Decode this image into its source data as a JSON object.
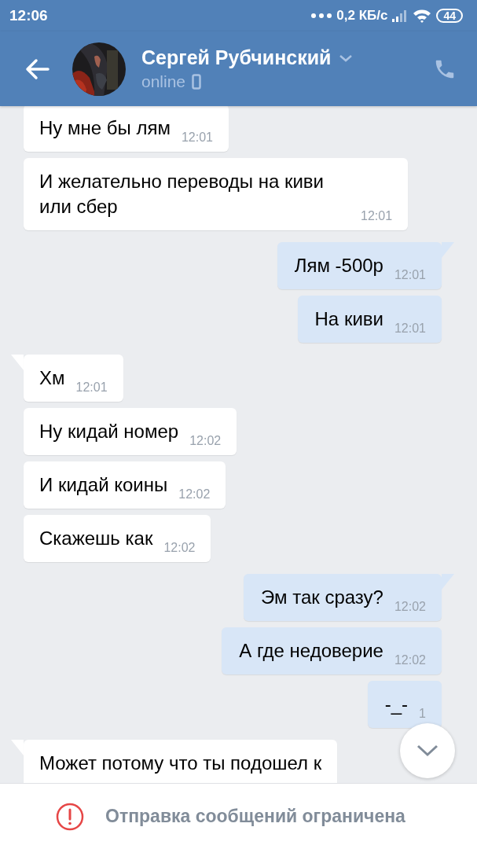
{
  "status_bar": {
    "time": "12:06",
    "speed": "0,2 КБ/с",
    "battery": "44"
  },
  "header": {
    "name": "Сергей Рубчинский",
    "status": "online"
  },
  "messages": [
    {
      "kind": "incoming",
      "first_in_group": false,
      "text": "Ну мне бы лям",
      "time": "12:01"
    },
    {
      "kind": "incoming",
      "first_in_group": false,
      "text": "И желательно переводы на киви или сбер",
      "time": "12:01"
    },
    {
      "kind": "outgoing",
      "first_in_group": true,
      "text": "Лям -500р",
      "time": "12:01"
    },
    {
      "kind": "outgoing",
      "first_in_group": false,
      "text": "На киви",
      "time": "12:01"
    },
    {
      "kind": "incoming",
      "first_in_group": true,
      "text": "Хм",
      "time": "12:01"
    },
    {
      "kind": "incoming",
      "first_in_group": false,
      "text": "Ну кидай номер",
      "time": "12:02"
    },
    {
      "kind": "incoming",
      "first_in_group": false,
      "text": "И кидай коины",
      "time": "12:02"
    },
    {
      "kind": "incoming",
      "first_in_group": false,
      "text": "Скажешь как",
      "time": "12:02"
    },
    {
      "kind": "outgoing",
      "first_in_group": true,
      "text": "Эм так сразу?",
      "time": "12:02"
    },
    {
      "kind": "outgoing",
      "first_in_group": false,
      "text": "А где недоверие",
      "time": "12:02"
    },
    {
      "kind": "outgoing",
      "first_in_group": false,
      "text": "-_-",
      "time": "1"
    },
    {
      "kind": "incoming",
      "first_in_group": true,
      "text": "Может потому что ты подошел к"
    }
  ],
  "notice": {
    "text": "Отправка сообщений ограничена"
  }
}
